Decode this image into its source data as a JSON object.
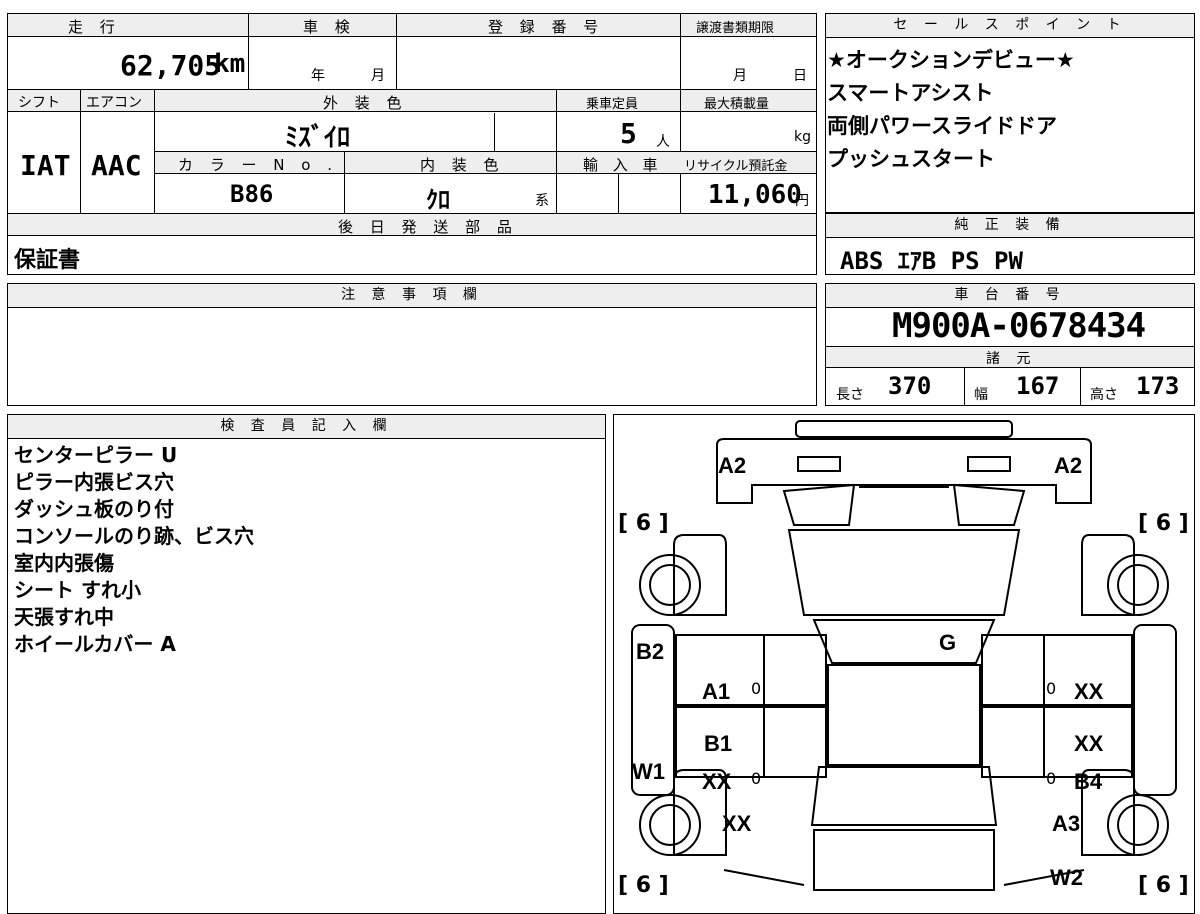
{
  "sheet": {
    "mileage_label": "走 行",
    "mileage_value": "62,705",
    "mileage_unit": "km",
    "inspection_label": "車 検",
    "year_label": "年",
    "month_label": "月",
    "registration_label": "登 録 番 号",
    "transfer_deadline_label": "譲渡書類期限",
    "deadline_month": "月",
    "deadline_day": "日",
    "shift_label": "シフト",
    "ac_label": "エアコン",
    "exterior_color_label": "外 装 色",
    "capacity_label": "乗車定員",
    "max_load_label": "最大積載量",
    "shift_value": "IAT",
    "ac_value": "AAC",
    "exterior_color_value": "ﾐｽﾞｲﾛ",
    "capacity_value": "5",
    "capacity_unit": "人",
    "load_unit": "kg",
    "color_no_label": "カ ラ ー N o .",
    "interior_color_label": "内 装 色",
    "import_label": "輸 入 車",
    "recycle_label": "リサイクル預託金",
    "color_no_value": "B86",
    "interior_color_value": "ｸﾛ",
    "interior_suffix": "系",
    "recycle_value": "11,060",
    "recycle_unit": "円",
    "later_parts_label": "後 日 発 送 部 品",
    "later_parts_value": "保証書",
    "notes_label": "注 意 事 項 欄",
    "inspector_label": "検 査 員 記 入 欄",
    "inspector_items": [
      "センターピラー U",
      "ピラー内張ビス穴",
      "ダッシュ板のり付",
      "コンソールのり跡、ビス穴",
      "室内内張傷",
      "シート すれ小",
      "天張すれ中",
      "ホイールカバー A"
    ]
  },
  "sales": {
    "label": "セ ー ル ス ポ イ ン ト",
    "points": [
      "★オークションデビュー★",
      "スマートアシスト",
      "両側パワースライドドア",
      "プッシュスタート"
    ]
  },
  "equipment": {
    "label": "純 正 装 備",
    "value": "ABS ｴｱB PS PW"
  },
  "chassis": {
    "label": "車 台 番 号",
    "value": "M900A-0678434",
    "spec_label": "諸 元",
    "length_label": "長さ",
    "length_value": "370",
    "width_label": "幅",
    "width_value": "167",
    "height_label": "高さ",
    "height_value": "173"
  },
  "diagram": {
    "tire_marks": [
      "[ 6 ]",
      "[ 6 ]",
      "[ 6 ]",
      "[ 6 ]"
    ],
    "zero_marks": [
      "0",
      "0",
      "0",
      "0"
    ],
    "labels": {
      "a2_left": "A2",
      "a2_right": "A2",
      "g": "G",
      "b2": "B2",
      "a1": "A1",
      "xx_r1": "XX",
      "b1": "B1",
      "xx_r2": "XX",
      "w1": "W1",
      "xx_l3": "XX",
      "b4": "B4",
      "xx_l4": "XX",
      "a3": "A3",
      "w2": "W2"
    }
  }
}
